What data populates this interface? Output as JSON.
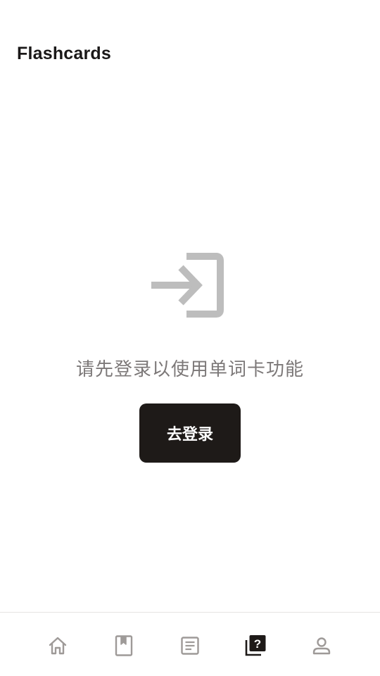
{
  "header": {
    "title": "Flashcards"
  },
  "empty_state": {
    "icon": "login-icon",
    "message": "请先登录以使用单词卡功能",
    "button_label": "去登录"
  },
  "bottom_nav": {
    "items": [
      {
        "icon": "home-icon",
        "active": false
      },
      {
        "icon": "book-bookmark-icon",
        "active": false
      },
      {
        "icon": "article-icon",
        "active": false
      },
      {
        "icon": "flashcards-quiz-icon",
        "active": true
      },
      {
        "icon": "profile-icon",
        "active": false
      }
    ]
  },
  "colors": {
    "primary": "#1e1a18",
    "muted_text": "#7c7878",
    "icon_inactive": "#9e9a98",
    "empty_icon": "#bdbdbd",
    "divider": "#e6e4e3"
  }
}
